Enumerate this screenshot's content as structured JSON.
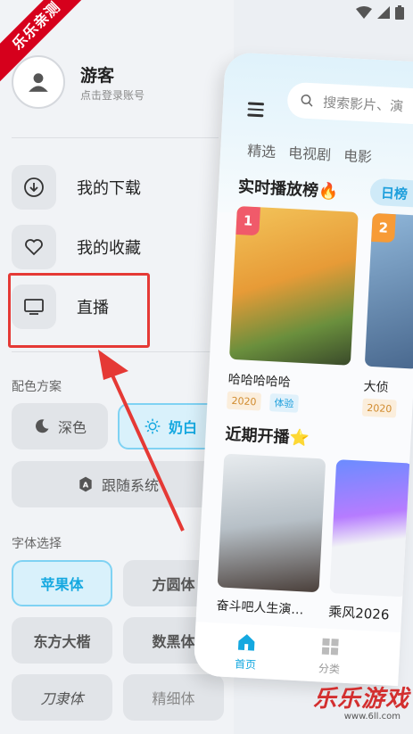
{
  "ribbon": "乐乐亲测",
  "profile": {
    "name": "游客",
    "hint": "点击登录账号"
  },
  "menu": [
    {
      "label": "我的下载",
      "icon": "download-icon"
    },
    {
      "label": "我的收藏",
      "icon": "heart-icon"
    },
    {
      "label": "直播",
      "icon": "tv-icon"
    }
  ],
  "color_scheme": {
    "title": "配色方案",
    "options": [
      {
        "label": "深色",
        "icon": "moon-icon"
      },
      {
        "label": "奶白",
        "icon": "sun-icon",
        "active": true
      },
      {
        "label": "跟随系统",
        "icon": "auto-icon"
      }
    ]
  },
  "fonts": {
    "title": "字体选择",
    "options": [
      "苹果体",
      "方圆体",
      "东方大楷",
      "数黑体",
      "刀隶体",
      "精细体"
    ],
    "selected": "苹果体"
  },
  "phone": {
    "search_placeholder": "搜索影片、演",
    "tabs": [
      "精选",
      "电视剧",
      "电影"
    ],
    "trending_title": "实时播放榜🔥",
    "day_chip": "日榜",
    "trending": [
      {
        "rank": "1",
        "title": "哈哈哈哈哈",
        "year": "2020",
        "tag": "体验"
      },
      {
        "rank": "2",
        "title": "大侦",
        "year": "2020",
        "tag": ""
      }
    ],
    "upcoming_title": "近期开播⭐",
    "upcoming": [
      {
        "title": "奋斗吧人生演…"
      },
      {
        "title": "乘风2026"
      }
    ],
    "nav": [
      {
        "label": "首页",
        "icon": "home-icon",
        "active": true
      },
      {
        "label": "分类",
        "icon": "grid-icon"
      }
    ]
  },
  "watermark": {
    "text": "乐乐游戏",
    "url": "www.6ll.com"
  },
  "colors": {
    "accent": "#14a8e0",
    "highlight": "#e53935",
    "ribbon": "#d6001c"
  }
}
